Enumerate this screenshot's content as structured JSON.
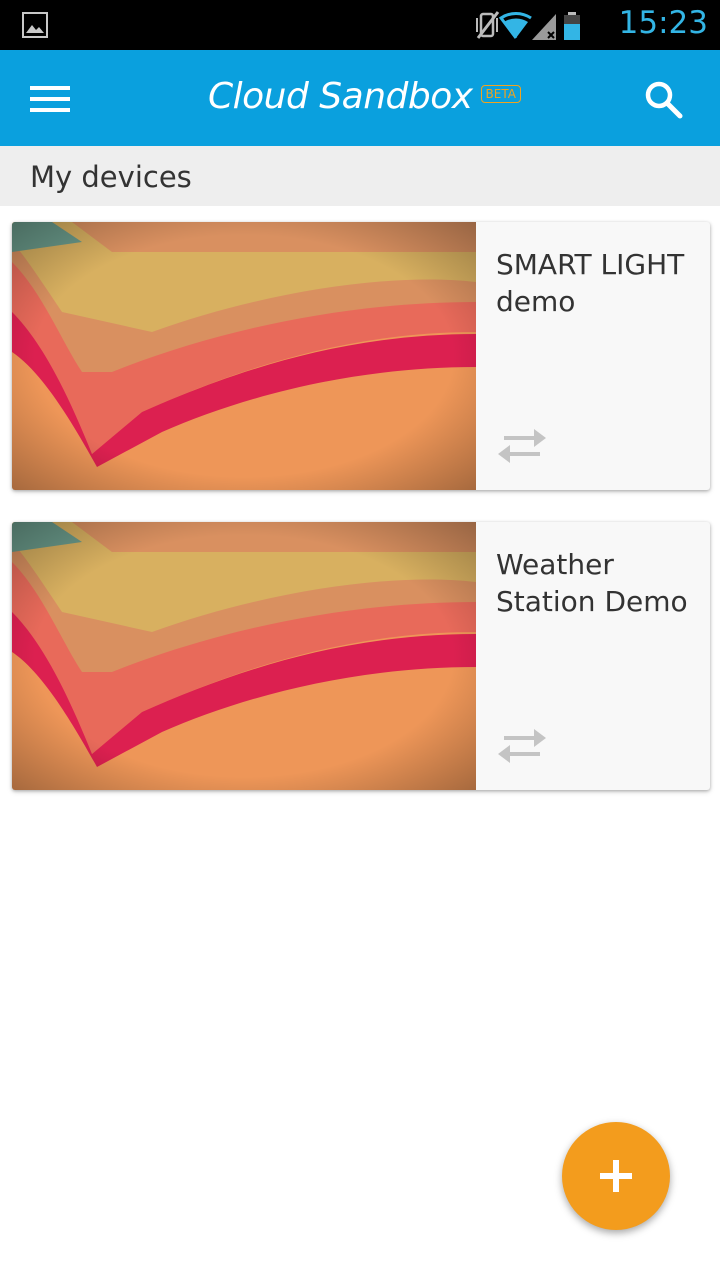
{
  "status_bar": {
    "time": "15:23",
    "icons": [
      "gallery-icon",
      "vibrate-off-icon",
      "wifi-icon",
      "signal-icon",
      "battery-icon"
    ]
  },
  "app_bar": {
    "title": "Cloud Sandbox",
    "badge": "BETA",
    "menu_icon": "hamburger-menu-icon",
    "search_icon": "search-icon",
    "color": "#0aa0de",
    "badge_color": "#f0a31f"
  },
  "section": {
    "header": "My devices"
  },
  "devices": [
    {
      "name": "SMART LIGHT demo",
      "sync_icon": "sync-arrows-icon"
    },
    {
      "name": "Weather Station Demo",
      "sync_icon": "sync-arrows-icon"
    }
  ],
  "fab": {
    "icon": "plus-icon",
    "color": "#f39c1d"
  }
}
